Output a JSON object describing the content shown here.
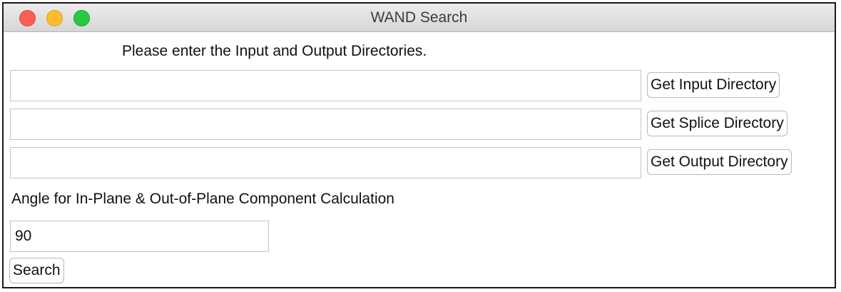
{
  "window": {
    "title": "WAND Search"
  },
  "prompt": "Please enter the Input and Output Directories.",
  "directories": {
    "input": {
      "value": "",
      "button_label": "Get Input Directory"
    },
    "splice": {
      "value": "",
      "button_label": "Get Splice Directory"
    },
    "output": {
      "value": "",
      "button_label": "Get Output Directory"
    }
  },
  "angle": {
    "label": "Angle for In-Plane & Out-of-Plane Component Calculation",
    "value": "90"
  },
  "search_button_label": "Search",
  "colors": {
    "close": "#fc5f57",
    "minimize": "#fdbc2e",
    "zoom": "#28c840"
  }
}
